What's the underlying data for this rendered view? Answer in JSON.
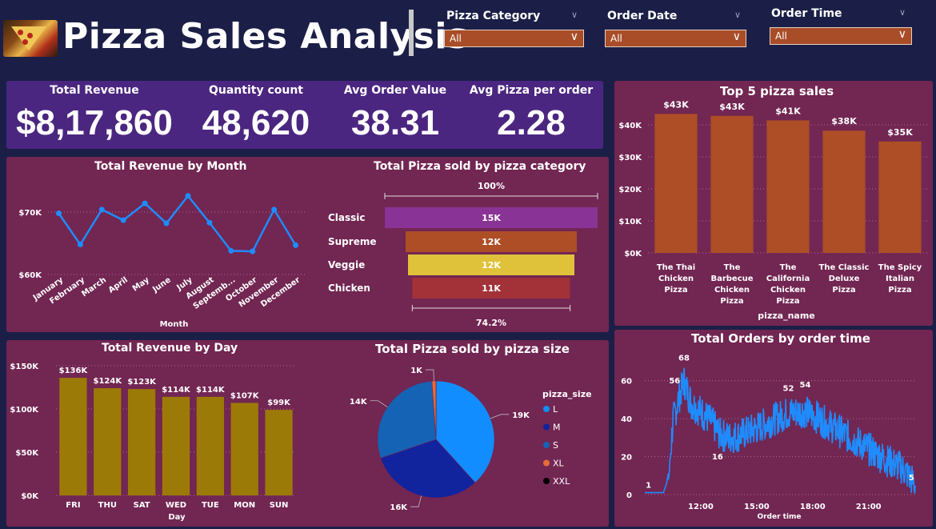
{
  "header": {
    "title": "Pizza Sales Analysis",
    "filters": [
      {
        "label": "Pizza Category",
        "value": "All"
      },
      {
        "label": "Order Date",
        "value": "All"
      },
      {
        "label": "Order Time",
        "value": "All"
      }
    ]
  },
  "kpis": [
    {
      "label": "Total Revenue",
      "value": "$8,17,860"
    },
    {
      "label": "Quantity count",
      "value": "48,620"
    },
    {
      "label": "Avg Order Value",
      "value": "38.31"
    },
    {
      "label": "Avg Pizza per order",
      "value": "2.28"
    }
  ],
  "colors": {
    "background": "#1b1f47",
    "panel": "#722652",
    "kpi_panel": "#4b2680",
    "bar_orange": "#ad4e27",
    "bar_olive": "#9b7a07",
    "line_blue": "#1e8cff"
  },
  "chart_data": [
    {
      "id": "revenue_by_month",
      "type": "line",
      "title": "Total Revenue by Month",
      "xlabel": "Month",
      "ylabel": "",
      "x": [
        "January",
        "February",
        "March",
        "April",
        "May",
        "June",
        "July",
        "August",
        "Septemb...",
        "October",
        "November",
        "December"
      ],
      "values": [
        69800,
        64800,
        70400,
        68700,
        71400,
        68200,
        72600,
        68300,
        63800,
        63700,
        70400,
        64700
      ],
      "yticks": [
        "$60K",
        "$70K"
      ],
      "ylim": [
        60000,
        75000
      ],
      "grid": true
    },
    {
      "id": "pizza_by_category",
      "type": "bar",
      "orientation": "funnel",
      "title": "Total Pizza sold by pizza category",
      "categories": [
        "Classic",
        "Supreme",
        "Veggie",
        "Chicken"
      ],
      "values": [
        14900,
        11990,
        11650,
        11050
      ],
      "labels": [
        "15K",
        "12K",
        "12K",
        "11K"
      ],
      "colors": [
        "#8a3397",
        "#ad4e27",
        "#e0c23a",
        "#a23238"
      ],
      "top_percent": "100%",
      "bottom_percent": "74.2%"
    },
    {
      "id": "top5_pizza",
      "type": "bar",
      "title": "Top 5 pizza sales",
      "xlabel": "pizza_name",
      "ylabel": "",
      "categories": [
        "The Thai Chicken Pizza",
        "The Barbecue Chicken Pizza",
        "The California Chicken Pizza",
        "The Classic Deluxe Pizza",
        "The Spicy Italian Pizza"
      ],
      "category_lines": [
        [
          "The Thai",
          "Chicken",
          "Pizza"
        ],
        [
          "The",
          "Barbecue",
          "Chicken",
          "Pizza"
        ],
        [
          "The",
          "California",
          "Chicken",
          "Pizza"
        ],
        [
          "The Classic",
          "Deluxe",
          "Pizza"
        ],
        [
          "The Spicy",
          "Italian",
          "Pizza"
        ]
      ],
      "values": [
        43400,
        42800,
        41400,
        38200,
        34800
      ],
      "labels": [
        "$43K",
        "$43K",
        "$41K",
        "$38K",
        "$35K"
      ],
      "yticks": [
        "$0K",
        "$10K",
        "$20K",
        "$30K",
        "$40K"
      ],
      "ylim": [
        0,
        45000
      ],
      "grid": true
    },
    {
      "id": "revenue_by_day",
      "type": "bar",
      "title": "Total Revenue by Day",
      "xlabel": "Day",
      "ylabel": "",
      "categories": [
        "FRI",
        "THU",
        "SAT",
        "WED",
        "TUE",
        "MON",
        "SUN"
      ],
      "values": [
        136000,
        124000,
        123000,
        114000,
        114000,
        107000,
        99000
      ],
      "labels": [
        "$136K",
        "$124K",
        "$123K",
        "$114K",
        "$114K",
        "$107K",
        "$99K"
      ],
      "yticks": [
        "$0K",
        "$50K",
        "$100K",
        "$150K"
      ],
      "ylim": [
        0,
        150000
      ],
      "grid": true
    },
    {
      "id": "pizza_by_size",
      "type": "pie",
      "title": "Total Pizza sold by pizza size",
      "legend_title": "pizza_size",
      "categories": [
        "L",
        "M",
        "S",
        "XL",
        "XXL"
      ],
      "values": [
        18956,
        15635,
        14403,
        552,
        28
      ],
      "labels": [
        "19K",
        "16K",
        "14K",
        "1K",
        ""
      ],
      "colors": [
        "#118dff",
        "#12239e",
        "#1563b5",
        "#e66c37",
        "#000000"
      ],
      "legend_position": "right"
    },
    {
      "id": "orders_by_time",
      "type": "line",
      "title": "Total Orders by order time",
      "xlabel": "Order time",
      "ylabel": "",
      "xticks": [
        "12:00",
        "15:00",
        "18:00",
        "21:00"
      ],
      "yticks": [
        "0",
        "20",
        "40",
        "60"
      ],
      "ylim": [
        0,
        70
      ],
      "xlim_hours": [
        9.0,
        23.5
      ],
      "annotations": [
        {
          "hour": 9.2,
          "value": 1,
          "label": "1"
        },
        {
          "hour": 10.6,
          "value": 56,
          "label": "56"
        },
        {
          "hour": 11.1,
          "value": 68,
          "label": "68"
        },
        {
          "hour": 12.9,
          "value": 16,
          "label": "16"
        },
        {
          "hour": 16.7,
          "value": 52,
          "label": "52"
        },
        {
          "hour": 17.6,
          "value": 54,
          "label": "54"
        },
        {
          "hour": 23.3,
          "value": 5,
          "label": "5"
        }
      ],
      "profile": [
        [
          9.0,
          1
        ],
        [
          10.0,
          1
        ],
        [
          10.3,
          10
        ],
        [
          10.5,
          38
        ],
        [
          10.8,
          50
        ],
        [
          11.1,
          60
        ],
        [
          11.5,
          48
        ],
        [
          12.0,
          44
        ],
        [
          12.6,
          38
        ],
        [
          13.0,
          32
        ],
        [
          13.5,
          30
        ],
        [
          14.0,
          31
        ],
        [
          15.0,
          35
        ],
        [
          16.0,
          40
        ],
        [
          16.7,
          43
        ],
        [
          17.5,
          44
        ],
        [
          18.2,
          41
        ],
        [
          19.0,
          36
        ],
        [
          20.0,
          30
        ],
        [
          21.0,
          24
        ],
        [
          22.0,
          18
        ],
        [
          22.8,
          14
        ],
        [
          23.3,
          8
        ],
        [
          23.5,
          5
        ]
      ],
      "grid": true
    }
  ]
}
